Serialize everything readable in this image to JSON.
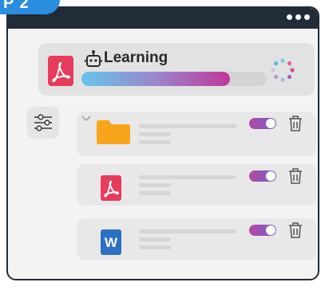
{
  "badge": {
    "label": "P 2"
  },
  "title_bar": {
    "menu_icon": "more-horizontal-icon"
  },
  "main_task": {
    "title": "Learning",
    "file_icon": "pdf-icon",
    "bot_icon": "robot-icon",
    "progress_fraction": 0.8,
    "status_icon": "loading-spinner-icon",
    "colors": {
      "pdf": "#e63b5c",
      "progress_start": "#67c4ec",
      "progress_end": "#c0389a"
    }
  },
  "filter": {
    "icon": "sliders-icon"
  },
  "files": [
    {
      "type": "folder",
      "icon": "folder-icon",
      "expand_icon": "chevron-down-icon",
      "toggle_on": true
    },
    {
      "type": "pdf",
      "icon": "pdf-icon",
      "toggle_on": true
    },
    {
      "type": "word",
      "icon": "word-icon",
      "glyph": "W",
      "toggle_on": true
    }
  ],
  "accent_colors": {
    "frame": "#222b38",
    "badge": "#2a8de0",
    "toggle": "#9a55b5"
  }
}
